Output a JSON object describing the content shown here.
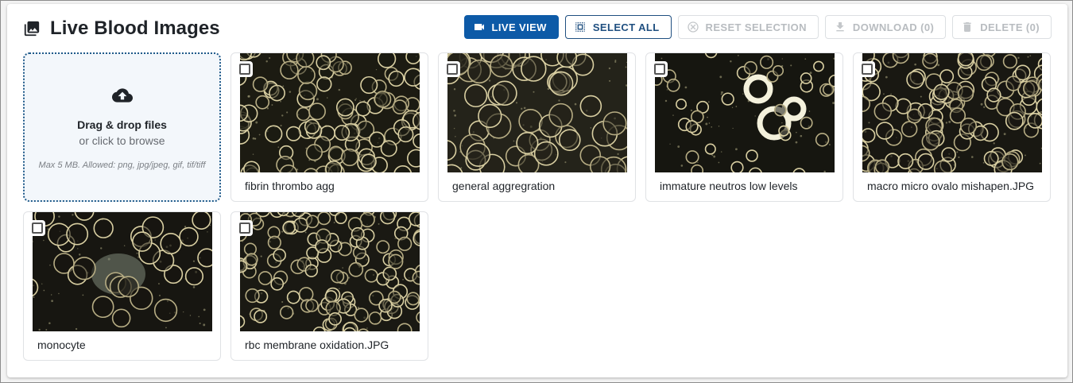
{
  "header": {
    "title": "Live Blood Images",
    "title_icon": "photo-library-icon"
  },
  "toolbar": {
    "live_view": "LIVE VIEW",
    "select_all": "SELECT ALL",
    "reset_selection": "RESET SELECTION",
    "download": "DOWNLOAD (0)",
    "delete": "DELETE (0)"
  },
  "upload": {
    "title": "Drag & drop files",
    "subtitle": "or click to browse",
    "hint": "Max 5 MB. Allowed: png, jpg/jpeg, gif, tif/tiff",
    "icon": "cloud-upload-icon"
  },
  "images": [
    {
      "name": "fibrin thrombo agg",
      "checked": false
    },
    {
      "name": "general aggregration",
      "checked": false
    },
    {
      "name": "immature neutros low levels",
      "checked": false
    },
    {
      "name": "macro micro ovalo mishapen.JPG",
      "checked": false
    },
    {
      "name": "monocyte",
      "checked": false
    },
    {
      "name": "rbc membrane oxidation.JPG",
      "checked": false
    }
  ],
  "colors": {
    "primary": "#0d5aa7",
    "outline": "#1f4f80",
    "disabled": "#b8bcc0",
    "upload_border": "#1f5a8a",
    "upload_bg": "#f3f7fb"
  }
}
